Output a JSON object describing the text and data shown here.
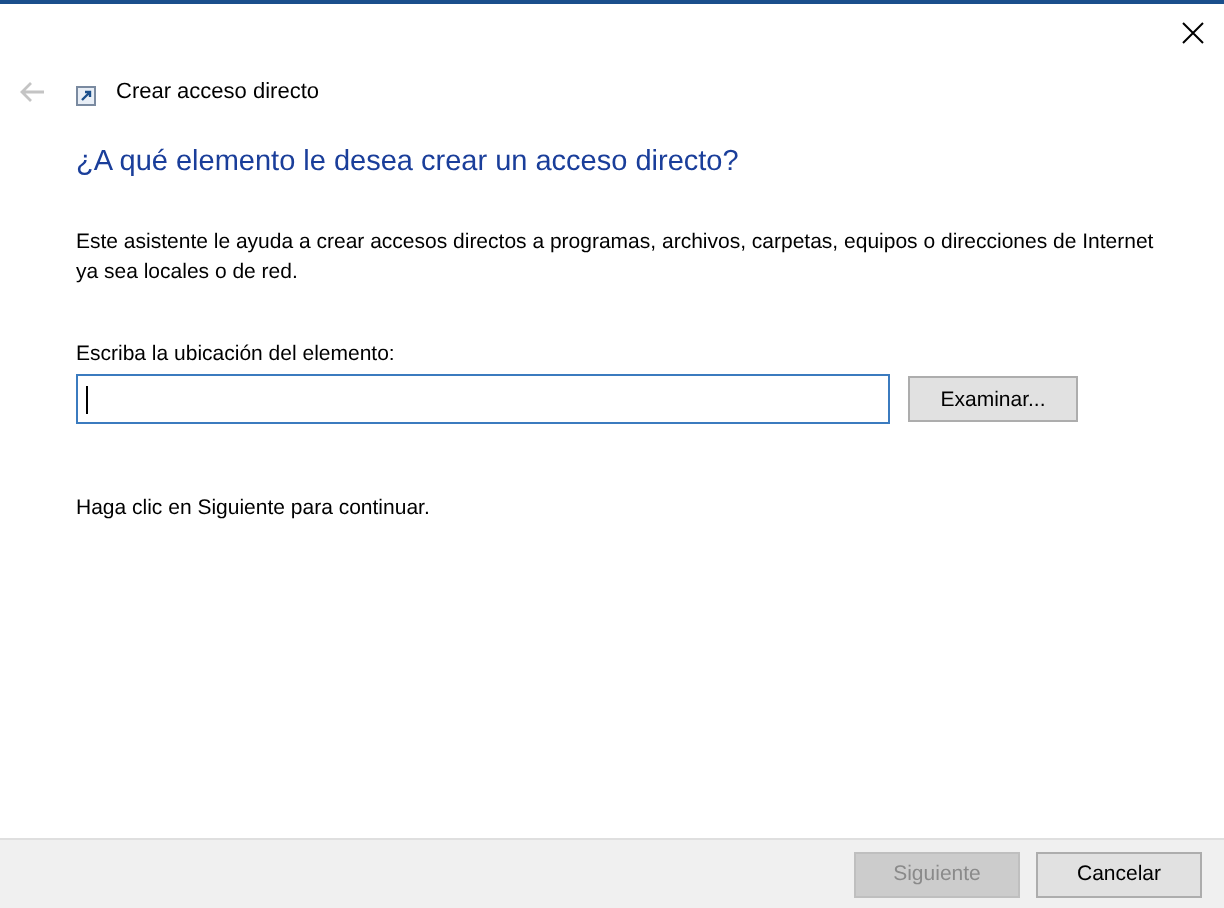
{
  "window": {
    "title": "Crear acceso directo"
  },
  "back_button": {
    "disabled": true
  },
  "heading": "¿A qué elemento le desea crear un acceso directo?",
  "description": "Este asistente le ayuda a crear accesos directos a programas, archivos, carpetas, equipos o direcciones de Internet ya sea locales o de red.",
  "location": {
    "label": "Escriba la ubicación del elemento:",
    "focused": true,
    "browse_button": "Examinar..."
  },
  "hint": "Haga clic en Siguiente para continuar.",
  "buttons": [
    {
      "label": "Siguiente",
      "disabled": true
    },
    {
      "label": "Cancelar",
      "disabled": false
    }
  ]
}
